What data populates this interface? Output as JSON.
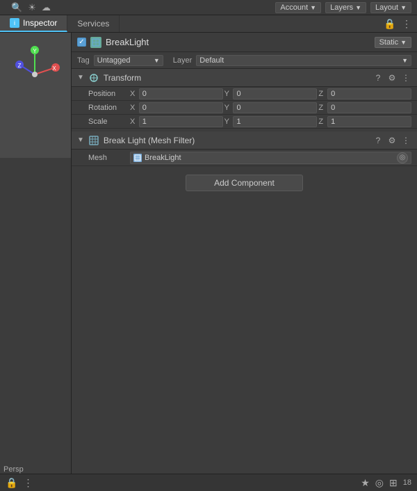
{
  "topbar": {
    "search_icon": "🔍",
    "cloud_icon": "☁",
    "account_label": "Account",
    "layers_label": "Layers",
    "layout_label": "Layout"
  },
  "tabs": {
    "inspector_label": "Inspector",
    "services_label": "Services",
    "icon_symbol": "i"
  },
  "object": {
    "name": "BreakLight",
    "static_label": "Static",
    "tag_label": "Tag",
    "tag_value": "Untagged",
    "layer_label": "Layer",
    "layer_value": "Default"
  },
  "transform": {
    "title": "Transform",
    "position_label": "Position",
    "rotation_label": "Rotation",
    "scale_label": "Scale",
    "pos_x": "0",
    "pos_y": "0",
    "pos_z": "0",
    "rot_x": "0",
    "rot_y": "0",
    "rot_z": "0",
    "scale_x": "1",
    "scale_y": "1",
    "scale_z": "1"
  },
  "mesh_filter": {
    "title": "Break Light (Mesh Filter)",
    "mesh_label": "Mesh",
    "mesh_value": "BreakLight"
  },
  "add_component": {
    "label": "Add Component"
  },
  "bottom": {
    "lock_icon": "🔒",
    "menu_icon": "⋮",
    "star_icon": "★",
    "target_icon": "◎",
    "count": "18"
  },
  "viewport": {
    "persp_label": "Persp"
  }
}
